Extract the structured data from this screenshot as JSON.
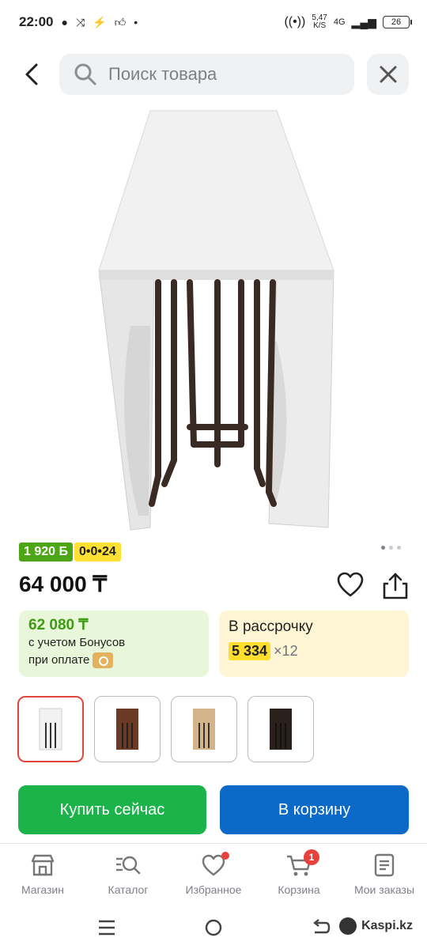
{
  "status_bar": {
    "time": "22:00",
    "net_speed_value": "5,47",
    "net_speed_unit": "K/S",
    "network": "4G",
    "battery": "26"
  },
  "search": {
    "placeholder": "Поиск товара"
  },
  "product": {
    "bonus_badge": "1 920 Б",
    "installment_badge": "0•0•24",
    "price": "64 000 ₸",
    "image_dots": [
      true,
      false,
      false
    ]
  },
  "bonus_card": {
    "amount": "62 080 ₸",
    "line1": "с учетом Бонусов",
    "line2": "при оплате"
  },
  "installment_card": {
    "title": "В рассрочку",
    "amount": "5 334",
    "months": "×12"
  },
  "thumbnails": [
    {
      "color": "#f2f2f2",
      "selected": true
    },
    {
      "color": "#6b3a24",
      "selected": false
    },
    {
      "color": "#d4b48a",
      "selected": false
    },
    {
      "color": "#2a201c",
      "selected": false
    }
  ],
  "actions": {
    "buy_now": "Купить сейчас",
    "add_to_cart": "В корзину"
  },
  "bottom_nav": {
    "items": [
      {
        "label": "Магазин",
        "icon": "shop-icon"
      },
      {
        "label": "Каталог",
        "icon": "catalog-search-icon"
      },
      {
        "label": "Избранное",
        "icon": "heart-icon"
      },
      {
        "label": "Корзина",
        "icon": "cart-icon"
      },
      {
        "label": "Мои заказы",
        "icon": "orders-icon"
      }
    ],
    "cart_badge": "1"
  },
  "watermark": "Kaspi.kz",
  "colors": {
    "accent_green": "#1bb34a",
    "accent_blue": "#0b69c7",
    "badge_red": "#e8413b"
  }
}
